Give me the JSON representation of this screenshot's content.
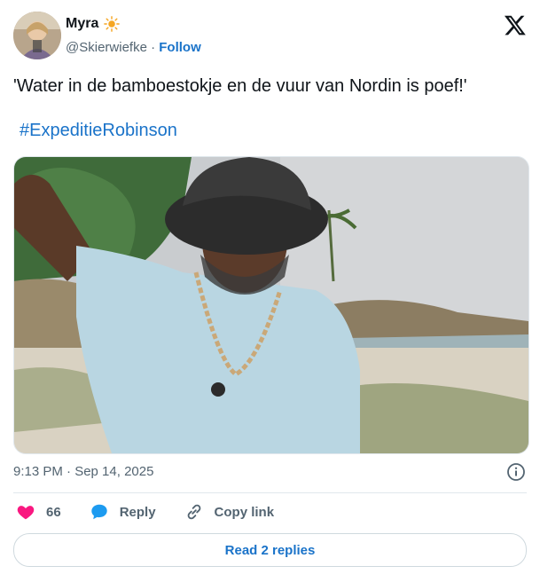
{
  "user": {
    "display_name": "Myra",
    "name_emoji_icon": "sun-icon",
    "handle": "@Skierwiefke",
    "separator": " · ",
    "follow_label": "Follow"
  },
  "tweet": {
    "text": "'Water in de bamboestokje en de vuur van Nordin is poef!'",
    "hashtag": "#ExpeditieRobinson",
    "timestamp": "9:13 PM · Sep 14, 2025"
  },
  "actions": {
    "like_count": "66",
    "reply_label": "Reply",
    "copy_link_label": "Copy link"
  },
  "footer": {
    "read_replies_label": "Read 2 replies"
  },
  "colors": {
    "link": "#1a73c9",
    "like": "#f91880",
    "reply_bubble": "#1d9bf0",
    "muted": "#536471"
  }
}
